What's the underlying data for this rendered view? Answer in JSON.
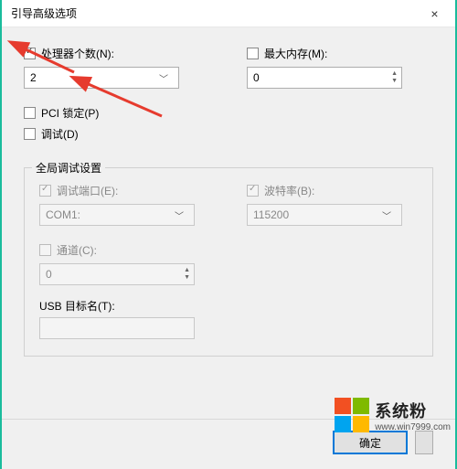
{
  "window": {
    "title": "引导高级选项",
    "close": "×"
  },
  "proc": {
    "label": "处理器个数(N):",
    "checked": true,
    "value": "2"
  },
  "mem": {
    "label": "最大内存(M):",
    "checked": false,
    "value": "0"
  },
  "pci": {
    "label": "PCI 锁定(P)",
    "checked": false
  },
  "debug": {
    "label": "调试(D)",
    "checked": false
  },
  "group": {
    "title": "全局调试设置",
    "port": {
      "label": "调试端口(E):",
      "value": "COM1:",
      "checked": true
    },
    "baud": {
      "label": "波特率(B):",
      "value": "115200",
      "checked": true
    },
    "channel": {
      "label": "通道(C):",
      "value": "0",
      "checked": false
    },
    "usb": {
      "label": "USB 目标名(T):",
      "value": ""
    }
  },
  "buttons": {
    "ok": "确定"
  },
  "watermark": {
    "line1": "系统粉",
    "line2": "www.win7999.com",
    "colors": [
      "#f25022",
      "#7fba00",
      "#00a4ef",
      "#ffb900"
    ]
  }
}
